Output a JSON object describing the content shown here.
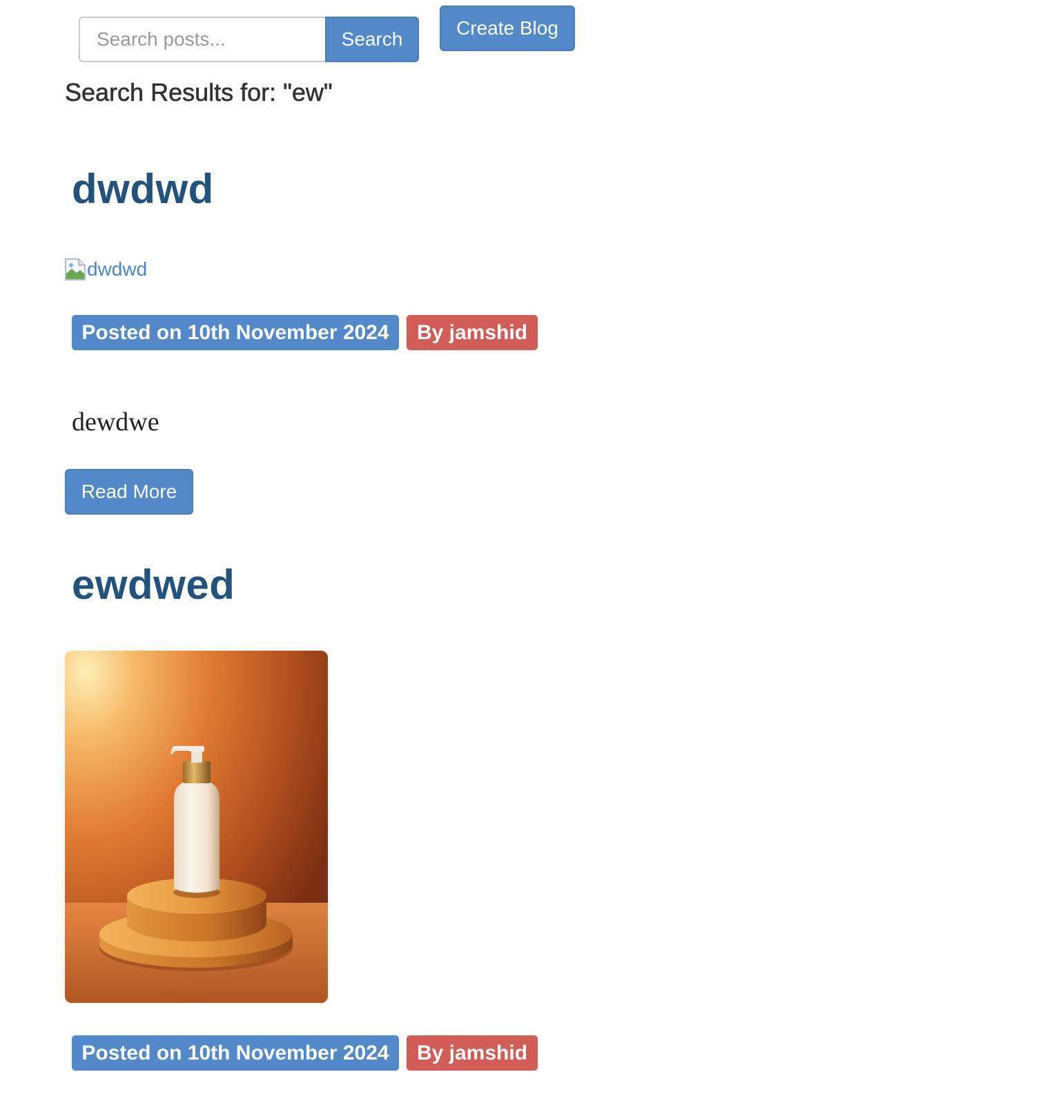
{
  "search": {
    "placeholder": "Search posts...",
    "value": "",
    "button_label": "Search"
  },
  "create_blog_label": "Create Blog",
  "results_heading": "Search Results for: \"ew\"",
  "posts": [
    {
      "title": "dwdwd",
      "image_alt": "dwdwd",
      "date_label": "Posted on 10th November 2024",
      "author_label": "By jamshid",
      "excerpt": "dewdwe",
      "read_more_label": "Read More"
    },
    {
      "title": "ewdwed",
      "date_label": "Posted on 10th November 2024",
      "author_label": "By jamshid"
    }
  ],
  "colors": {
    "primary": "#5389c9",
    "danger": "#d25c56",
    "title": "#23527c",
    "link": "#4a86c6"
  },
  "icons": {
    "broken_image": "broken-image-icon"
  }
}
